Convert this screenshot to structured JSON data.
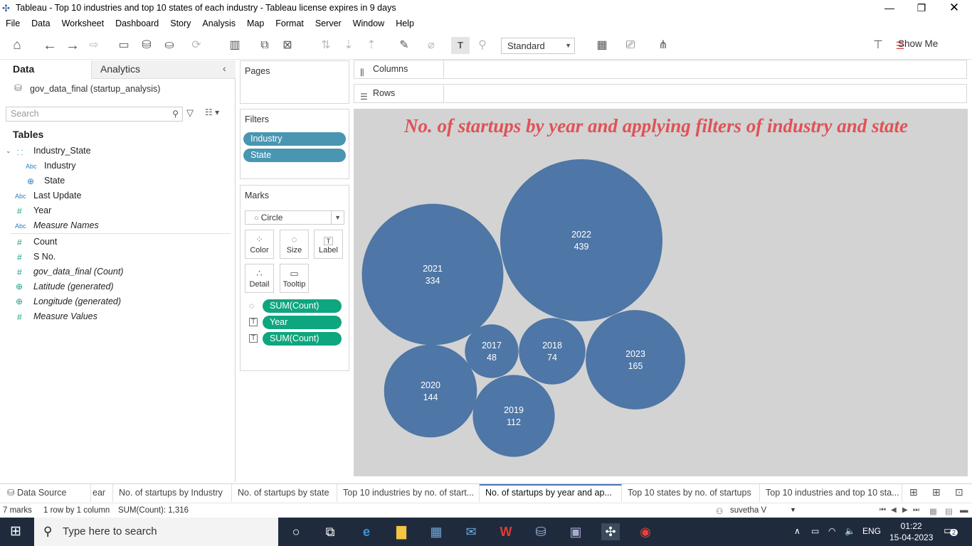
{
  "window": {
    "title": "Tableau - Top 10 industries and top 10 states of each industry - Tableau license expires in 9 days"
  },
  "menu": [
    "File",
    "Data",
    "Worksheet",
    "Dashboard",
    "Story",
    "Analysis",
    "Map",
    "Format",
    "Server",
    "Window",
    "Help"
  ],
  "toolbar": {
    "fit_mode": "Standard",
    "show_me": "Show Me"
  },
  "data_pane": {
    "tab_data": "Data",
    "tab_analytics": "Analytics",
    "datasource": "gov_data_final (startup_analysis)",
    "search_placeholder": "Search",
    "tables_heading": "Tables",
    "fields": [
      {
        "name": "Industry_State",
        "type": "hierarchy",
        "italic": false
      },
      {
        "name": "Industry",
        "type": "Abc",
        "italic": false
      },
      {
        "name": "State",
        "type": "geo",
        "italic": false
      },
      {
        "name": "Last Update",
        "type": "Abc",
        "italic": false
      },
      {
        "name": "Year",
        "type": "#",
        "italic": false
      },
      {
        "name": "Measure Names",
        "type": "Abc",
        "italic": true
      },
      {
        "name": "Count",
        "type": "#",
        "italic": false
      },
      {
        "name": "S No.",
        "type": "#",
        "italic": false
      },
      {
        "name": "gov_data_final (Count)",
        "type": "#",
        "italic": true
      },
      {
        "name": "Latitude (generated)",
        "type": "geo",
        "italic": true
      },
      {
        "name": "Longitude (generated)",
        "type": "geo",
        "italic": true
      },
      {
        "name": "Measure Values",
        "type": "#",
        "italic": true
      }
    ]
  },
  "pages_card": {
    "title": "Pages"
  },
  "filters_card": {
    "title": "Filters",
    "pills": [
      "Industry",
      "State"
    ]
  },
  "marks_card": {
    "title": "Marks",
    "mark_type": "Circle",
    "buttons": [
      "Color",
      "Size",
      "Label",
      "Detail",
      "Tooltip"
    ],
    "pills": [
      {
        "icon": "size",
        "label": "SUM(Count)"
      },
      {
        "icon": "label",
        "label": "Year"
      },
      {
        "icon": "label",
        "label": "SUM(Count)"
      }
    ]
  },
  "shelves": {
    "columns": "Columns",
    "rows": "Rows"
  },
  "viz": {
    "title": "No. of startups by year and applying filters of industry and state",
    "bubble_color": "#4e76a6",
    "background": "#d3d3d3"
  },
  "chart_data": {
    "type": "bubble",
    "title": "No. of startups by year and applying filters of industry and state",
    "categories": [
      "2017",
      "2018",
      "2019",
      "2020",
      "2021",
      "2022",
      "2023"
    ],
    "values": [
      48,
      74,
      112,
      144,
      334,
      439,
      165
    ]
  },
  "sheet_tabs": {
    "data_source": "Data Source",
    "tabs": [
      "ear",
      "No. of startups by Industry",
      "No. of startups by state",
      "Top 10 industries by no. of start...",
      "No. of startups by year and ap...",
      "Top 10 states by no. of startups",
      "Top 10 industries and top 10 sta..."
    ],
    "active_index": 4
  },
  "status": {
    "marks": "7 marks",
    "rows_cols": "1 row by 1 column",
    "sum": "SUM(Count): 1,316",
    "user": "suvetha V"
  },
  "taskbar": {
    "search_placeholder": "Type here to search",
    "lang": "ENG",
    "time": "01:22",
    "date": "15-04-2023",
    "notifications": "2"
  }
}
